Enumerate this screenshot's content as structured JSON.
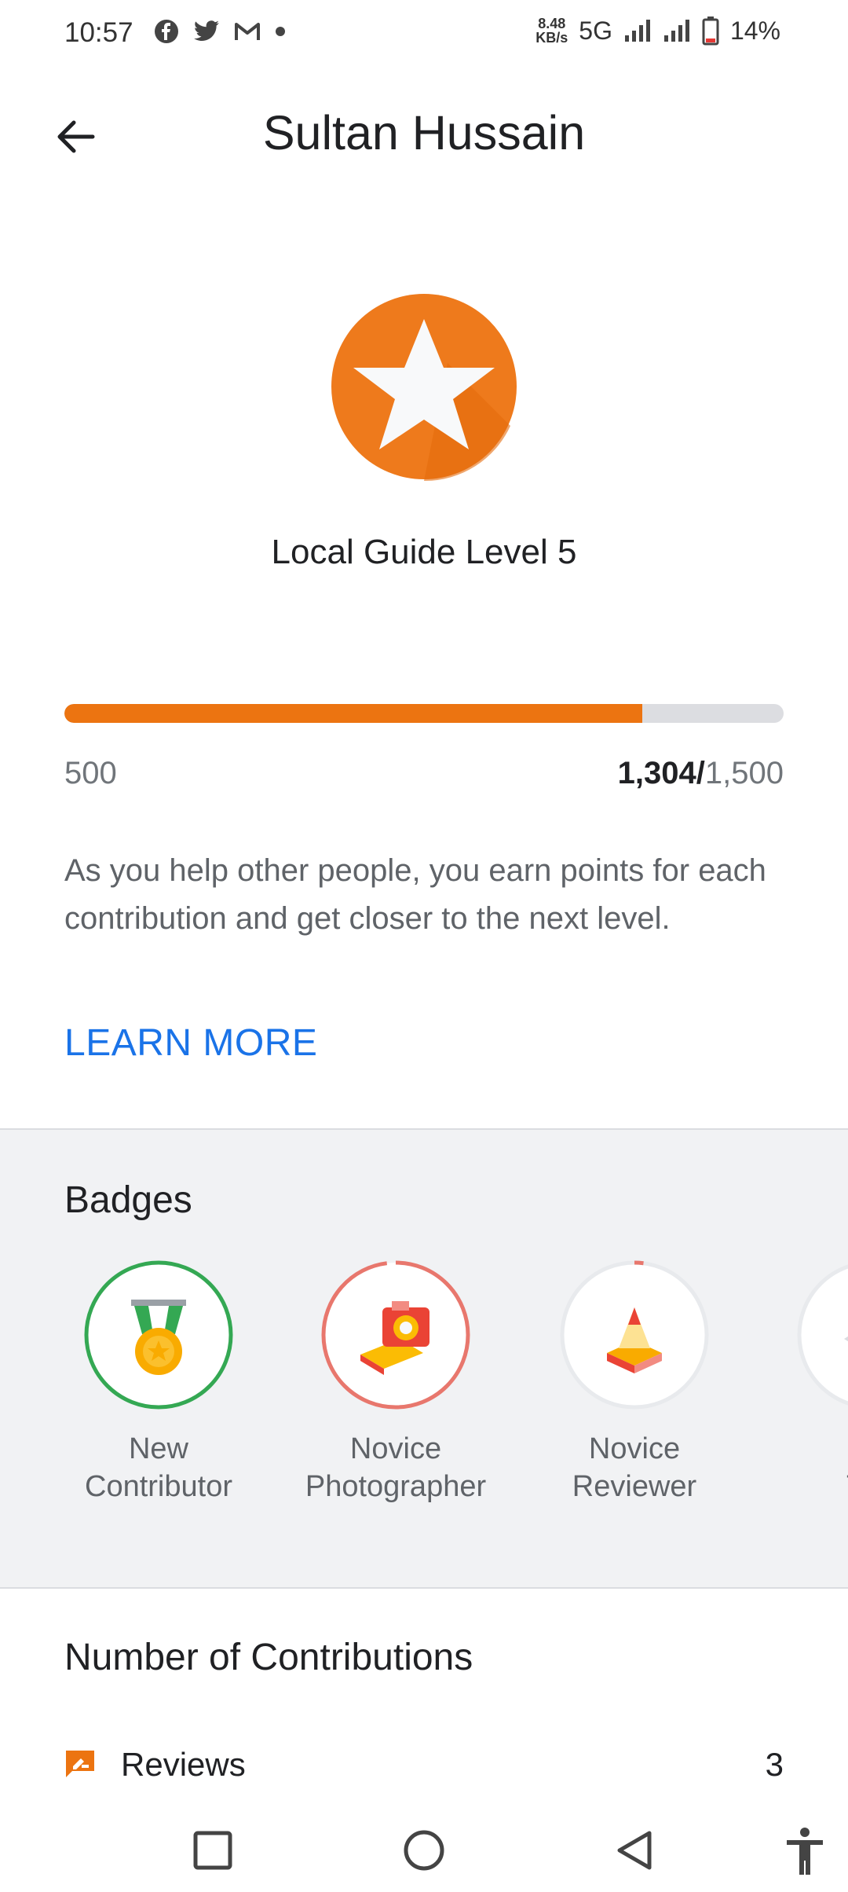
{
  "status_bar": {
    "time": "10:57",
    "speed_value": "8.48",
    "speed_unit": "KB/s",
    "network": "5G",
    "battery": "14%"
  },
  "header": {
    "title": "Sultan Hussain"
  },
  "level": {
    "text": "Local Guide Level 5",
    "progress_fraction": 0.804,
    "progress_min": "500",
    "current_points": "1,304/",
    "next_level_points": "1,500",
    "description": "As you help other people, you earn points for each contribution and get closer to the next level.",
    "learn_more": "LEARN MORE"
  },
  "badges": {
    "title": "Badges",
    "items": [
      {
        "line1": "New",
        "line2": "Contributor",
        "icon": "medal-icon",
        "ring_color": "#34a853",
        "progress": 1.0
      },
      {
        "line1": "Novice",
        "line2": "Photographer",
        "icon": "camera-icon",
        "ring_color": "#e8776d",
        "progress": 0.98
      },
      {
        "line1": "Novice",
        "line2": "Reviewer",
        "icon": "pencil-icon",
        "ring_color": "#e8776d",
        "progress": 0.02
      },
      {
        "line1": "U",
        "line2": "Trai",
        "icon": "badge-icon",
        "ring_color": "#5f6368",
        "progress": 0.5
      }
    ]
  },
  "contributions": {
    "title": "Number of Contributions",
    "reviews_label": "Reviews",
    "reviews_count": "3"
  },
  "colors": {
    "accent": "#ec7411",
    "link": "#1a73e8"
  }
}
